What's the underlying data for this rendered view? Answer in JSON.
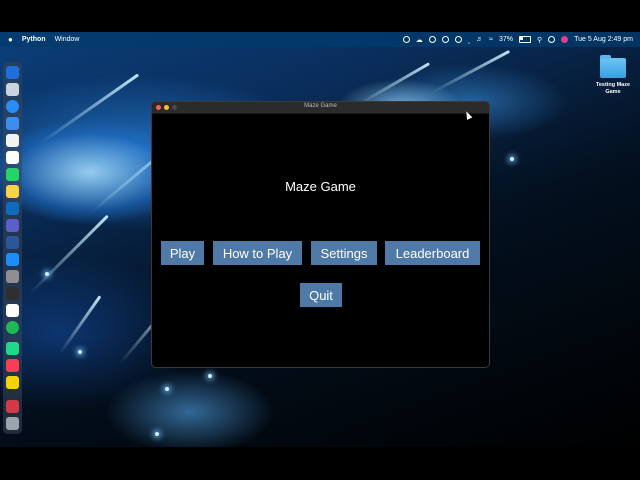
{
  "menubar": {
    "apple_icon": "apple-icon",
    "app_name": "Python",
    "menus": [
      "Window"
    ],
    "battery_percent": "37%",
    "datetime": "Tue 5 Aug  2:49 pm"
  },
  "desktop": {
    "folder_label": "Testing Maze Game"
  },
  "window": {
    "title": "Maze Game",
    "game_title": "Maze Game",
    "buttons": {
      "play": "Play",
      "how_to_play": "How to Play",
      "settings": "Settings",
      "leaderboard": "Leaderboard",
      "quit": "Quit"
    }
  },
  "colors": {
    "button_bg": "#4f7aa7",
    "window_bg": "#000000",
    "close": "#ff5f57",
    "minimize": "#febc2e"
  }
}
